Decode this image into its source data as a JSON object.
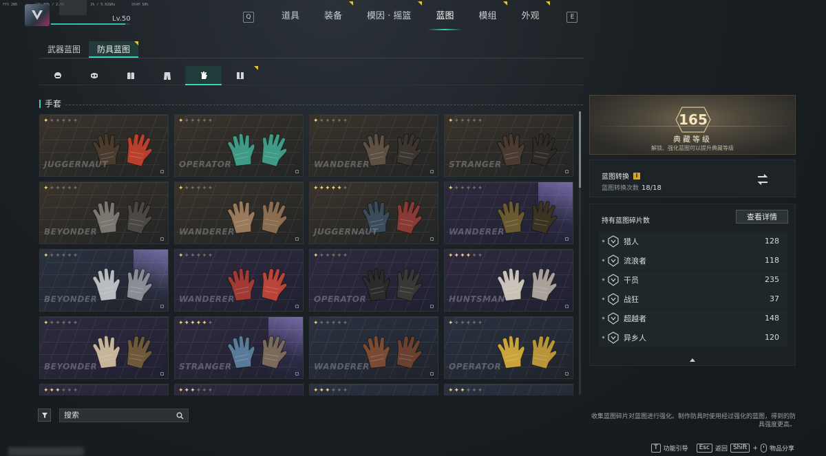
{
  "hud": {
    "fps_label": "FPS",
    "fps": "286",
    "gpu_label": "GPU",
    "gpu": "80% / 2.8G",
    "cpu": "1% / 5.02GHz",
    "dram_label": "DRAM",
    "dram": "58%"
  },
  "player": {
    "level": "Lv.50",
    "xp_progress": 0.95
  },
  "topnav": {
    "left_key": "Q",
    "right_key": "E",
    "tabs": [
      {
        "label": "道具",
        "flag": false
      },
      {
        "label": "装备",
        "flag": true
      },
      {
        "label": "模因 · 摇篮",
        "flag": true
      },
      {
        "label": "蓝图",
        "flag": false,
        "active": true
      },
      {
        "label": "模组",
        "flag": true
      },
      {
        "label": "外观",
        "flag": true
      }
    ]
  },
  "subtabs": [
    {
      "label": "武器蓝图",
      "active": false
    },
    {
      "label": "防具蓝图",
      "active": true
    }
  ],
  "slots": [
    {
      "icon": "helmet-icon"
    },
    {
      "icon": "mask-icon"
    },
    {
      "icon": "chest-armor-icon"
    },
    {
      "icon": "pants-icon"
    },
    {
      "icon": "glove-icon",
      "active": true
    },
    {
      "icon": "boots-icon",
      "flag": true
    }
  ],
  "section_title": "手套",
  "cards": [
    {
      "brand": "JUGGERNAUT",
      "stars": 1,
      "theme": "bronze",
      "colors": [
        "#4a3b2e",
        "#b8402c"
      ]
    },
    {
      "brand": "OPERATOR",
      "stars": 1,
      "theme": "bronze",
      "colors": [
        "#3f9b85",
        "#3f9b85"
      ]
    },
    {
      "brand": "WANDERER",
      "stars": 1,
      "theme": "bronze",
      "colors": [
        "#5e5144",
        "#3c352f"
      ]
    },
    {
      "brand": "STRANGER",
      "stars": 1,
      "theme": "bronze",
      "colors": [
        "#4a3a30",
        "#2e2a28"
      ]
    },
    {
      "brand": "BEYONDER",
      "stars": 1,
      "theme": "bronze",
      "colors": [
        "#7b7670",
        "#4a4744"
      ]
    },
    {
      "brand": "WANDERER",
      "stars": 1,
      "theme": "bronze",
      "colors": [
        "#9a7a5c",
        "#8a6c50"
      ]
    },
    {
      "brand": "JUGGERNAUT",
      "stars": 5,
      "theme": "bronze",
      "colors": [
        "#3a4b5c",
        "#8a3a34"
      ]
    },
    {
      "brand": "WANDERER",
      "stars": 1,
      "theme": "purple",
      "glow": true,
      "colors": [
        "#6a5a30",
        "#3a3322"
      ]
    },
    {
      "brand": "BEYONDER",
      "stars": 1,
      "theme": "navy",
      "glow": true,
      "colors": [
        "#b8bcc0",
        "#8a8e94"
      ]
    },
    {
      "brand": "WANDERER",
      "stars": 1,
      "theme": "purple",
      "colors": [
        "#a03a34",
        "#b8443a"
      ]
    },
    {
      "brand": "OPERATOR",
      "stars": 1,
      "theme": "purple",
      "colors": [
        "#2c2b2a",
        "#3a3836"
      ]
    },
    {
      "brand": "HUNTSMAN",
      "stars": 4,
      "theme": "purple",
      "colors": [
        "#c8c2b8",
        "#a8a29a"
      ]
    },
    {
      "brand": "BEYONDER",
      "stars": 1,
      "theme": "purple",
      "colors": [
        "#c6b59a",
        "#6e5a3a"
      ]
    },
    {
      "brand": "STRANGER",
      "stars": 5,
      "theme": "purple",
      "glow": true,
      "colors": [
        "#5a7a9a",
        "#7a6a5a"
      ]
    },
    {
      "brand": "WANDERER",
      "stars": 1,
      "theme": "navy",
      "colors": [
        "#7a4a34",
        "#6a4030"
      ]
    },
    {
      "brand": "OPERATOR",
      "stars": 1,
      "theme": "navy",
      "colors": [
        "#c9a43a",
        "#b8943a"
      ]
    },
    {
      "brand": "",
      "stars": 3,
      "theme": "purple",
      "colors": [
        "#555",
        "#555"
      ]
    },
    {
      "brand": "",
      "stars": 3,
      "theme": "purple",
      "colors": [
        "#555",
        "#555"
      ]
    },
    {
      "brand": "",
      "stars": 3,
      "theme": "navy",
      "colors": [
        "#555",
        "#555"
      ]
    },
    {
      "brand": "",
      "stars": 3,
      "theme": "navy",
      "colors": [
        "#555",
        "#555"
      ]
    }
  ],
  "grid_scroll": 0.27,
  "search": {
    "placeholder": "搜索"
  },
  "collection": {
    "level": "165",
    "title": "典藏等级",
    "subtitle": "解锁、强化蓝图可以提升典藏等级"
  },
  "convert": {
    "title": "蓝图转换",
    "count_label": "蓝图转换次数",
    "count": "18/18"
  },
  "fragments": {
    "title": "持有蓝图碎片数",
    "detail_button": "查看详情",
    "items": [
      {
        "name": "猎人",
        "count": "128"
      },
      {
        "name": "流浪者",
        "count": "118"
      },
      {
        "name": "干员",
        "count": "235"
      },
      {
        "name": "战狂",
        "count": "37"
      },
      {
        "name": "超越者",
        "count": "148"
      },
      {
        "name": "异乡人",
        "count": "120"
      }
    ]
  },
  "tip": "收集蓝图碎片对蓝图进行强化。制作防具时使用经过强化的蓝图，得到的防具强度更高。",
  "footer": {
    "guide_key": "T",
    "guide_label": "功能引导",
    "back_key": "Esc",
    "back_label": "返回",
    "share_key": "Shift",
    "plus": "+",
    "share_label": "物品分享"
  }
}
